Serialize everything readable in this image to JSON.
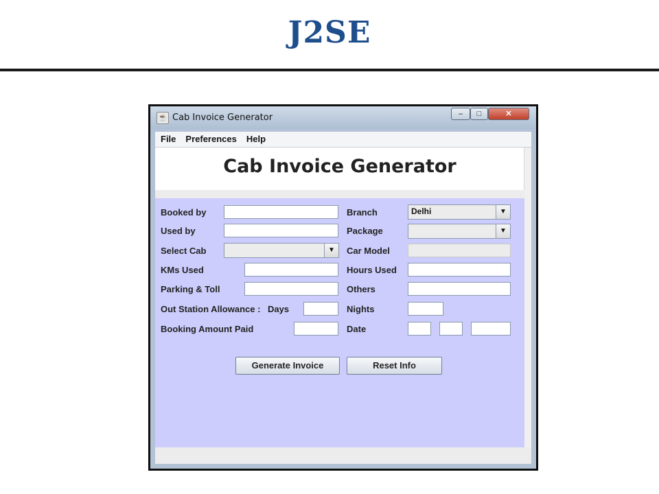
{
  "slide": {
    "title": "J2SE"
  },
  "window": {
    "title": "Cab Invoice Generator",
    "controls": {
      "minimize": "‒",
      "maximize": "□",
      "close": "✕"
    }
  },
  "menu": [
    "File",
    "Preferences",
    "Help"
  ],
  "header": {
    "title": "Cab Invoice Generator"
  },
  "form": {
    "booked_by": {
      "label": "Booked by",
      "value": ""
    },
    "used_by": {
      "label": "Used by",
      "value": ""
    },
    "select_cab": {
      "label": "Select Cab",
      "value": ""
    },
    "kms_used": {
      "label": "KMs Used",
      "value": ""
    },
    "parking_toll": {
      "label": "Parking & Toll",
      "value": ""
    },
    "outstation": {
      "label": "Out Station Allowance :",
      "days_label": "Days",
      "days_value": ""
    },
    "booking_amount": {
      "label": "Booking Amount Paid",
      "value": ""
    },
    "branch": {
      "label": "Branch",
      "value": "Delhi"
    },
    "package": {
      "label": "Package",
      "value": ""
    },
    "car_model": {
      "label": "Car Model",
      "value": ""
    },
    "hours_used": {
      "label": "Hours Used",
      "value": ""
    },
    "others": {
      "label": "Others",
      "value": ""
    },
    "nights": {
      "label": "Nights",
      "value": ""
    },
    "date": {
      "label": "Date",
      "day": "",
      "month": "",
      "year": ""
    }
  },
  "buttons": {
    "generate": "Generate Invoice",
    "reset": "Reset Info"
  },
  "colors": {
    "slide_title": "#1f4e8c",
    "form_background": "#cccdfc",
    "header_background": "#ffffff"
  }
}
